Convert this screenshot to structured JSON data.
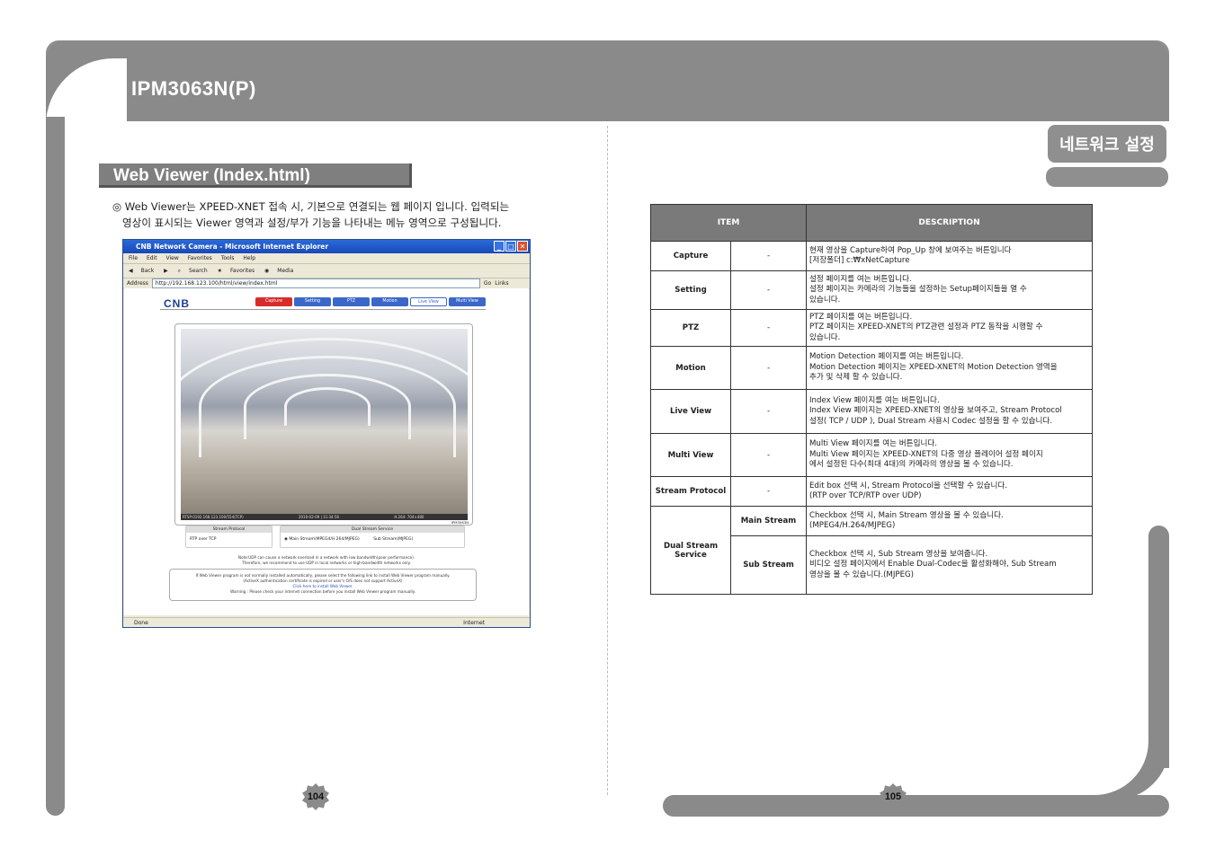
{
  "header": {
    "title": "IPM3063N(P)",
    "section_tab": "네트워크 설정"
  },
  "left": {
    "section_title": "Web Viewer (Index.html)",
    "intro_line1": "◎ Web Viewer는 XPEED-XNET 접속 시, 기본으로 연결되는 웹 페이지 입니다. 입력되는",
    "intro_line2": "영상이 표시되는 Viewer 영역과 설정/부가 기능을 나타내는 메뉴 영역으로 구성됩니다.",
    "page_number": "104"
  },
  "browser": {
    "window_title": "CNB Network Camera - Microsoft Internet Explorer",
    "menu": [
      "File",
      "Edit",
      "View",
      "Favorites",
      "Tools",
      "Help"
    ],
    "toolbar": [
      "Back",
      "Search",
      "Favorites",
      "Media"
    ],
    "address_label": "Address",
    "address": "http://192.168.123.100/html/view/index.html",
    "go": "Go",
    "links": "Links",
    "logo": "CNB",
    "nav": [
      "Capture",
      "Setting",
      "PTZ",
      "Motion",
      "Live View",
      "Multi View"
    ],
    "video_status_left": "RTSP:0192.168.123.100/554(TCP)",
    "video_status_mid": "2010-02-09 | 11:34:56",
    "video_status_right": "H.264: 704×480",
    "video_caption": "IPM3063N",
    "stream_protocol_label": "Stream Protocol",
    "stream_protocol_value": "RTP over TCP",
    "dual_stream_label": "Dual Stream Service",
    "main_stream_option": "Main Stream(MPEG4/H.264/MJPEG)",
    "sub_stream_option": "Sub Stream(MJPEG)",
    "note_line1": "Note:UDP can cause a network overload in a network with low bandwidth(poor performance).",
    "note_line2": "Therefore, we recommend to use UDP in local networks or high-bandwidth networks only.",
    "warn_line1": "If Web Viewer program is not normally installed automatically, please select the following link to install Web Viewer program manually.",
    "warn_line2": "(ActiveX authentication certificate is expired or user's O/S does not support ActiveX)",
    "warn_link": "Click here to install Web Viewer.",
    "warn_line3": "Warning : Please check your internet connection before you install Web Viewer program manually.",
    "status_done": "Done",
    "status_zone": "Internet"
  },
  "table": {
    "headers": [
      "ITEM",
      "DESCRIPTION"
    ],
    "rows": [
      {
        "item": "Capture",
        "sub": "-",
        "desc": [
          "현재 영상을 Capture하여 Pop_Up 창에 보여주는 버튼입니다",
          "[저장폴더]   c:₩xNetCapture"
        ]
      },
      {
        "item": "Setting",
        "sub": "-",
        "desc": [
          "설정 페이지를 여는 버튼입니다.",
          "설정 페이지는 카메라의 기능들을 설정하는 Setup페이지들을 열 수",
          "있습니다."
        ]
      },
      {
        "item": "PTZ",
        "sub": "-",
        "desc": [
          "PTZ 페이지를 여는 버튼입니다.",
          "PTZ 페이지는 XPEED-XNET의 PTZ관련 설정과 PTZ 동작을 시행할 수",
          "있습니다."
        ]
      },
      {
        "item": "Motion",
        "sub": "-",
        "desc": [
          "Motion Detection 페이지를 여는 버튼입니다.",
          "Motion Detection 페이지는 XPEED-XNET의 Motion Detection 영역을",
          "추가 및 삭제 할 수 있습니다."
        ]
      },
      {
        "item": "Live View",
        "sub": "-",
        "desc": [
          "Index View 페이지를 여는 버튼입니다.",
          "Index View 페이지는 XPEED-XNET의 영상을 보여주고, Stream Protocol",
          "설정( TCP / UDP ), Dual Stream 사용시 Codec 설정을 할 수 있습니다."
        ]
      },
      {
        "item": "Multi View",
        "sub": "-",
        "desc": [
          "Multi View 페이지를 여는 버튼입니다.",
          "Multi View 페이지는 XPEED-XNET의 다중 영상 플레이어 설정 페이지",
          "에서 설정된 다수(최대 4대)의 카메라의 영상을 볼 수 있습니다."
        ]
      },
      {
        "item": "Stream Protocol",
        "sub": "-",
        "desc": [
          "Edit box 선택 시, Stream Protocol을 선택할 수 있습니다.",
          "(RTP over TCP/RTP over UDP)"
        ]
      }
    ],
    "dual_item": "Dual Stream Service",
    "dual_rows": [
      {
        "sub": "Main Stream",
        "desc": [
          "Checkbox 선택 시, Main Stream 영상을 볼 수 있습니다.",
          "(MPEG4/H.264/MJPEG)"
        ]
      },
      {
        "sub": "Sub Stream",
        "desc": [
          "Checkbox 선택 시, Sub Stream 영상을 보여줍니다.",
          "비디오 설정 페이지에서 Enable Dual-Codec을 활성화해야, Sub Stream",
          "영상을 볼 수 있습니다.(MJPEG)"
        ]
      }
    ]
  },
  "right": {
    "page_number": "105"
  }
}
